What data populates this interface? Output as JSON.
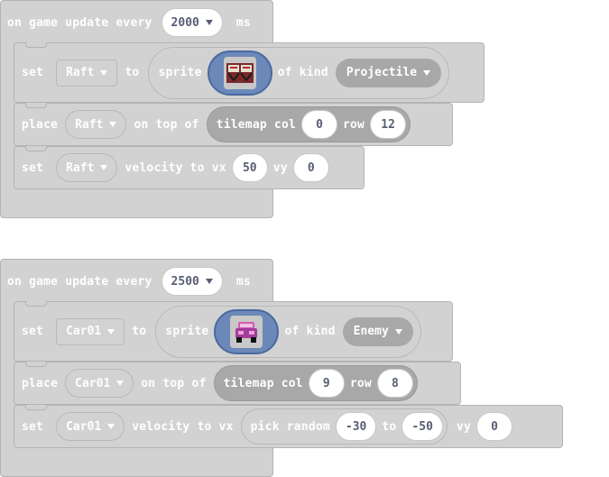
{
  "blocks": [
    {
      "hat": {
        "kw1": "on game update every",
        "interval": "2000",
        "kw2": "ms"
      },
      "set_sprite": {
        "kw_set": "set",
        "var": "Raft",
        "kw_to": "to",
        "kw_sprite": "sprite",
        "image": "raft-sprite-icon",
        "kw_kind": "of kind",
        "kind": "Projectile"
      },
      "place": {
        "kw_place": "place",
        "var": "Raft",
        "kw_ontop": "on top of",
        "kw_tilemap": "tilemap col",
        "col": "0",
        "kw_row": "row",
        "row": "12"
      },
      "velocity": {
        "kw_set": "set",
        "var": "Raft",
        "kw_vel": "velocity to vx",
        "vx": "50",
        "kw_vy": "vy",
        "vy": "0"
      }
    },
    {
      "hat": {
        "kw1": "on game update every",
        "interval": "2500",
        "kw2": "ms"
      },
      "set_sprite": {
        "kw_set": "set",
        "var": "Car01",
        "kw_to": "to",
        "kw_sprite": "sprite",
        "image": "car-sprite-icon",
        "kw_kind": "of kind",
        "kind": "Enemy"
      },
      "place": {
        "kw_place": "place",
        "var": "Car01",
        "kw_ontop": "on top of",
        "kw_tilemap": "tilemap col",
        "col": "9",
        "kw_row": "row",
        "row": "8"
      },
      "velocity": {
        "kw_set": "set",
        "var": "Car01",
        "kw_vel": "velocity to vx",
        "kw_random": "pick random",
        "min": "-30",
        "kw_rto": "to",
        "max": "-50",
        "kw_vy": "vy",
        "vy": "0"
      }
    }
  ],
  "colors": {
    "block": "#d2d2d2",
    "reporter": "#a8a8a8",
    "image_slot": "#6b88b8",
    "text_on_block": "#ffffff",
    "pill_text": "#575e75"
  }
}
